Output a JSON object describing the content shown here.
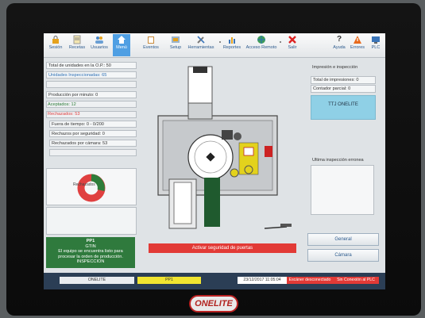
{
  "toolbar": {
    "items": [
      {
        "label": "Sesión",
        "icon": "lock-icon"
      },
      {
        "label": "Recetas",
        "icon": "recipe-icon"
      },
      {
        "label": "Usuarios",
        "icon": "users-icon"
      },
      {
        "label": "Menú",
        "icon": "home-icon",
        "active": true
      },
      {
        "label": "Eventos",
        "icon": "clipboard-icon"
      },
      {
        "label": "Setup",
        "icon": "setup-icon"
      },
      {
        "label": "Herramientas",
        "icon": "tools-icon"
      },
      {
        "label": "Reportes",
        "icon": "reports-icon"
      },
      {
        "label": "Acceso Remoto",
        "icon": "globe-icon"
      },
      {
        "label": "Salir",
        "icon": "close-icon"
      },
      {
        "label": "Ayuda",
        "icon": "help-icon"
      },
      {
        "label": "Errores",
        "icon": "warning-icon"
      },
      {
        "label": "PLC",
        "icon": "monitor-icon"
      }
    ]
  },
  "left": {
    "total": "Total de unidades en la O.P.: 50",
    "inspected": "Unidades Inspeccionadas: 65",
    "per_minute": "Producción por minuto: 0",
    "accepted": "Aceptados: 12",
    "rejected": "Rechazados: 53",
    "out_of_time": "Fuera de tiempo: 0 - 0/200",
    "rej_security": "Rechazos por seguridad: 0",
    "rej_camera": "Rechazados por cámara: 53",
    "donut_label": "Rechazados",
    "message": [
      "PP1",
      "GTIN",
      "El equipo se encuentra listo para",
      "procesar la orden de producción.",
      "INSPECCION"
    ]
  },
  "center": {
    "alert": "Activar seguridad de puertas"
  },
  "right": {
    "print_title": "Impresión e inspección",
    "total_prints": "Total de impresiones: 0",
    "partial_counter": "Contador parcial: 0",
    "ttj": "TTJ ONELITE",
    "last_error": "Ultima inspección erronea",
    "general_btn": "General",
    "camera_btn": "Cámara"
  },
  "status": {
    "machine": "ONELITE",
    "product": "PP1",
    "datetime": "23/12/2017 11:05:04",
    "scanner": "Escáner desconectado",
    "plc": "Sin Conexión al PLC"
  },
  "brand": "ONELITE",
  "colors": {
    "accent": "#4f9fe3",
    "alert": "#e23a36",
    "ok": "#2f7a3d",
    "rejected": "#e04040",
    "accepted": "#2e7d3a"
  }
}
